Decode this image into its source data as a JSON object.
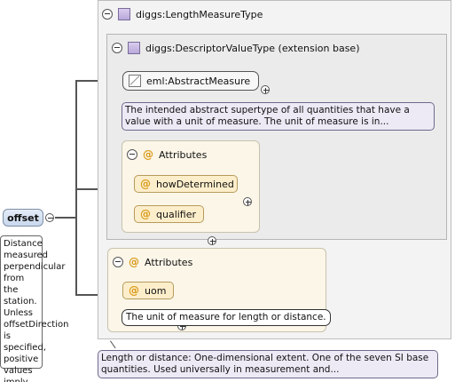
{
  "element": {
    "name": "offset",
    "documentation": "Distance measured perpendicular from the station. Unless offsetDirection is specified, positive values imply an offset..."
  },
  "type": {
    "name": "diggs:LengthMeasureType",
    "documentation": "Length or distance: One-dimensional extent. One of the seven SI base quantities. Used universally in measurement and..."
  },
  "base": {
    "name": "diggs:DescriptorValueType (extension base)",
    "abstract_element": "eml:AbstractMeasure",
    "abstract_documentation": "The intended abstract supertype of all quantities that have a value with a unit of measure. The unit of measure is in...",
    "attributes_label": "Attributes",
    "attributes": [
      "howDetermined",
      "qualifier"
    ]
  },
  "type_attributes": {
    "label": "Attributes",
    "uom": "uom",
    "uom_documentation": "The unit of measure for length or distance."
  },
  "colors": {
    "attribute_fill": "#fdeecb",
    "element_fill": "#c9d8ee",
    "documentation_fill": "#edeaf6",
    "type_icon": "#b8a8da"
  },
  "icons": [
    "collapse-icon",
    "expand-icon",
    "complex-type-icon",
    "abstract-element-icon",
    "attribute-icon"
  ]
}
